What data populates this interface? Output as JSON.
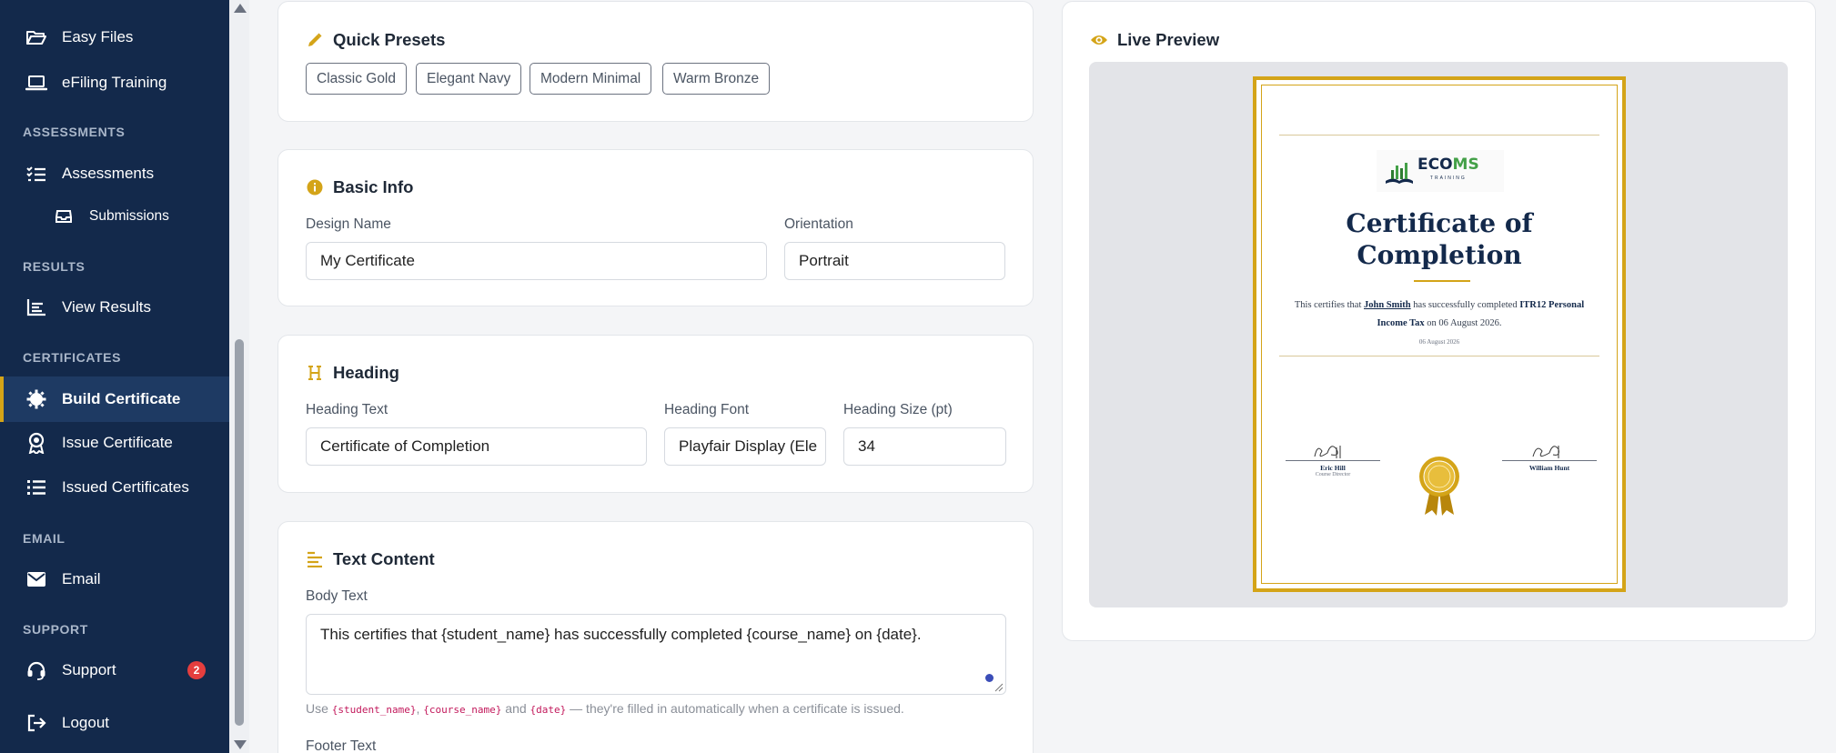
{
  "sidebar": {
    "items": [
      {
        "label": "Easy Files",
        "icon": "folder-open-icon"
      },
      {
        "label": "eFiling Training",
        "icon": "laptop-icon"
      },
      {
        "label": "Assessments",
        "icon": "list-check-icon"
      },
      {
        "label": "Submissions",
        "icon": "inbox-icon"
      },
      {
        "label": "View Results",
        "icon": "bar-chart-icon"
      },
      {
        "label": "Build Certificate",
        "icon": "gear-badge-icon"
      },
      {
        "label": "Issue Certificate",
        "icon": "award-icon"
      },
      {
        "label": "Issued Certificates",
        "icon": "list-icon"
      },
      {
        "label": "Email",
        "icon": "envelope-icon"
      },
      {
        "label": "Support",
        "icon": "headset-icon",
        "badge": "2"
      },
      {
        "label": "Logout",
        "icon": "logout-icon"
      }
    ],
    "sections": {
      "assessments": "ASSESSMENTS",
      "results": "RESULTS",
      "certificates": "CERTIFICATES",
      "email": "EMAIL",
      "support": "SUPPORT"
    },
    "accent": "#d4a418",
    "background": "#13294b"
  },
  "quick_presets": {
    "title": "Quick Presets",
    "items": [
      "Classic Gold",
      "Elegant Navy",
      "Modern Minimal",
      "Warm Bronze"
    ]
  },
  "basic_info": {
    "title": "Basic Info",
    "design_name_label": "Design Name",
    "design_name_value": "My Certificate",
    "orientation_label": "Orientation",
    "orientation_value": "Portrait"
  },
  "heading": {
    "title": "Heading",
    "text_label": "Heading Text",
    "text_value": "Certificate of Completion",
    "font_label": "Heading Font",
    "font_value": "Playfair Display (Ele",
    "size_label": "Heading Size (pt)",
    "size_value": "34"
  },
  "text_content": {
    "title": "Text Content",
    "body_label": "Body Text",
    "body_value": "This certifies that {student_name} has successfully completed {course_name} on {date}.",
    "help_prefix": "Use",
    "help_token1": "{student_name}",
    "help_sep1": ",",
    "help_token2": "{course_name}",
    "help_and": "and",
    "help_token3": "{date}",
    "help_suffix": "— they're filled in automatically when a certificate is issued.",
    "footer_label": "Footer Text"
  },
  "live_preview": {
    "title": "Live Preview",
    "certificate": {
      "logo_text_a": "ECO",
      "logo_text_b": "MS",
      "logo_sub": "TRAINING",
      "title_line1": "Certificate of",
      "title_line2": "Completion",
      "body_pre": "This certifies that",
      "student": "John Smith",
      "body_mid": "has successfully completed",
      "course_a": "ITR12",
      "course_b": "Personal Income Tax",
      "body_post": "on 06 August 2026.",
      "date": "06 August 2026",
      "sig1_name": "Eric Hill",
      "sig1_role": "Course Director",
      "sig2_name": "William Hunt"
    }
  }
}
